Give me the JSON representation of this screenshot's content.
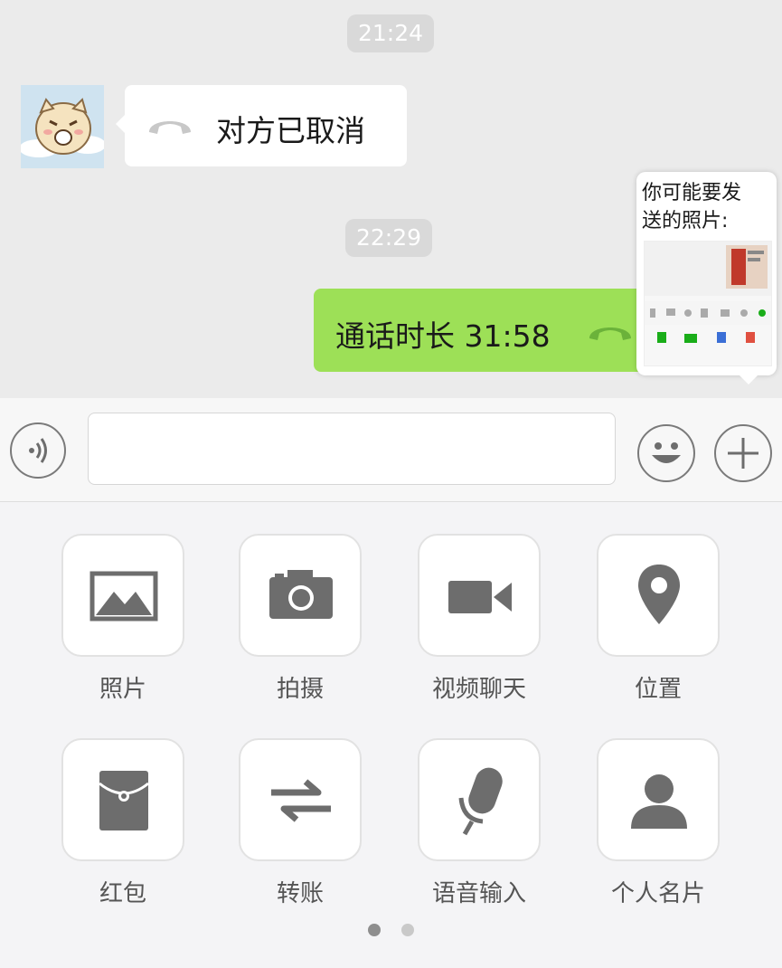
{
  "chat": {
    "timestamp_1": "21:24",
    "timestamp_2": "22:29",
    "incoming_call_text": "对方已取消",
    "outgoing_call_text": "通话时长 31:58"
  },
  "photo_suggestion": {
    "title_line1": "你可能要发",
    "title_line2": "送的照片:"
  },
  "panel": {
    "items": [
      {
        "label": "照片",
        "icon": "image-icon"
      },
      {
        "label": "拍摄",
        "icon": "camera-icon"
      },
      {
        "label": "视频聊天",
        "icon": "video-camera-icon"
      },
      {
        "label": "位置",
        "icon": "location-pin-icon"
      },
      {
        "label": "红包",
        "icon": "red-packet-icon"
      },
      {
        "label": "转账",
        "icon": "transfer-icon"
      },
      {
        "label": "语音输入",
        "icon": "microphone-icon"
      },
      {
        "label": "个人名片",
        "icon": "contact-card-icon"
      }
    ]
  },
  "colors": {
    "outgoing_bubble": "#9de057",
    "icon_gray": "#6d6d6d",
    "page_active_dot": "#8e8e8e",
    "page_inactive_dot": "#c9c9c9"
  }
}
